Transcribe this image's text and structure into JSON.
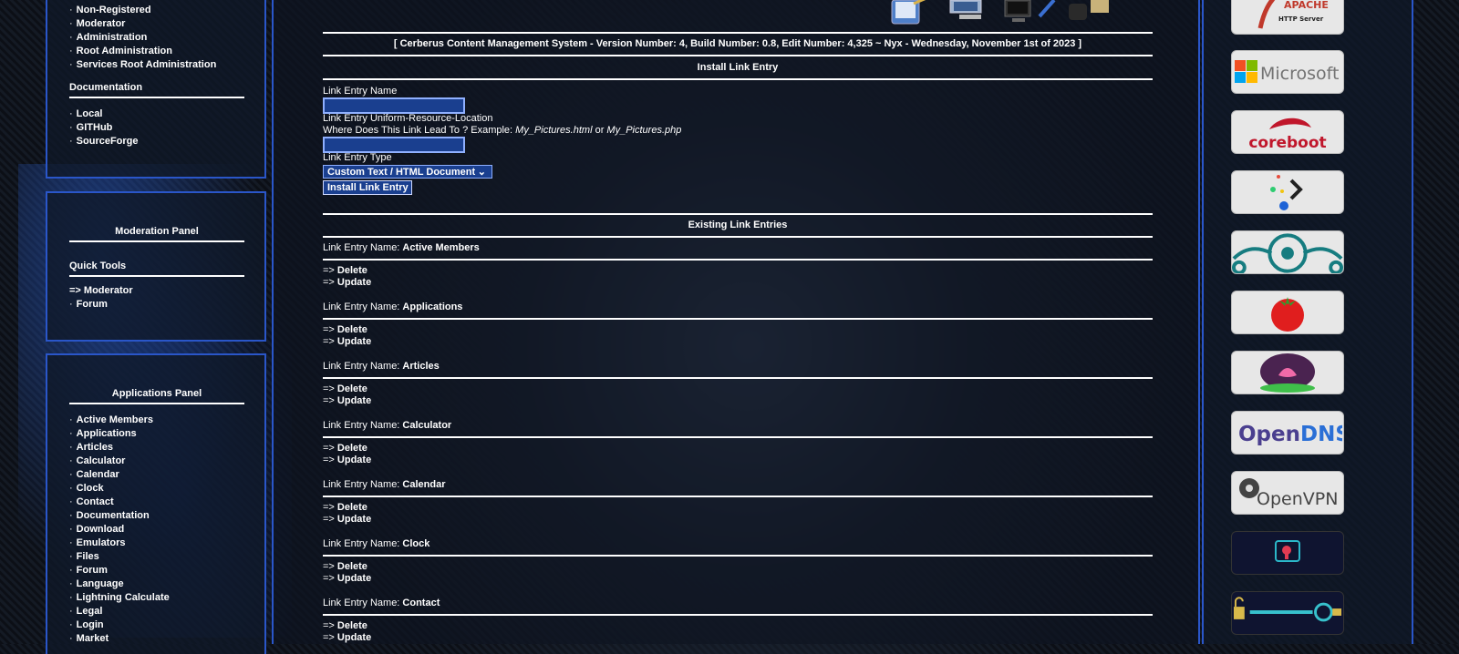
{
  "top_panel": {
    "items": [
      "Non-Registered",
      "Moderator",
      "Administration",
      "Root Administration",
      "Services Root Administration"
    ],
    "documentation_title": "Documentation",
    "doc_items": [
      "Local",
      "GITHub",
      "SourceForge"
    ]
  },
  "moderation_panel": {
    "title": "Moderation Panel",
    "quick_tools": "Quick Tools",
    "items": [
      "=> Moderator",
      "Forum"
    ]
  },
  "applications_panel": {
    "title": "Applications Panel",
    "items": [
      "Active Members",
      "Applications",
      "Articles",
      "Calculator",
      "Calendar",
      "Clock",
      "Contact",
      "Documentation",
      "Download",
      "Emulators",
      "Files",
      "Forum",
      "Language",
      "Lightning Calculate",
      "Legal",
      "Login",
      "Market"
    ]
  },
  "main": {
    "banner": "[ Cerberus Content Management System - Version Number: 4, Build Number: 0.8, Edit Number: 4,325 ~ Nyx - Wednesday, November 1st of 2023 ]",
    "install_title": "Install Link Entry",
    "name_label": "Link Entry Name",
    "url_label": "Link Entry Uniform-Resource-Location",
    "url_hint_prefix": "Where Does This Link Lead To ? Example: ",
    "url_hint_ex1": "My_Pictures.html",
    "url_hint_or": " or ",
    "url_hint_ex2": "My_Pictures.php",
    "type_label": "Link Entry Type",
    "type_selected": "Custom Text / HTML Document",
    "install_button": "Install Link Entry",
    "existing_title": "Existing Link Entries",
    "entry_label": "Link Entry Name: ",
    "delete_label": "Delete",
    "update_label": "Update",
    "arrow": "=> ",
    "entries": [
      "Active Members",
      "Applications",
      "Articles",
      "Calculator",
      "Calendar",
      "Clock",
      "Contact"
    ]
  },
  "sponsors": {
    "logos": [
      {
        "icon": "apache-logo",
        "text": "APACHE",
        "subtext": "HTTP Server"
      },
      {
        "icon": "microsoft-logo",
        "text": "Microsoft"
      },
      {
        "icon": "coreboot-logo",
        "text": "coreboot"
      },
      {
        "icon": "dots-arrow-logo"
      },
      {
        "icon": "lineageos-logo"
      },
      {
        "icon": "tomato-logo"
      },
      {
        "icon": "lotus-logo"
      },
      {
        "icon": "opendns-logo",
        "text_open": "Open",
        "text_dns": "DNS"
      },
      {
        "icon": "openvpn-logo",
        "text": "OpenVPN"
      },
      {
        "icon": "security-key-logo"
      },
      {
        "icon": "lock-key-logo"
      }
    ]
  }
}
